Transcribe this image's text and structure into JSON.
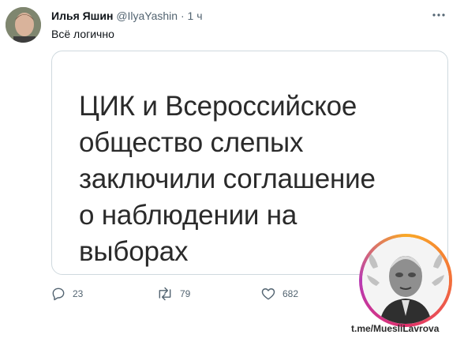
{
  "tweet": {
    "author_name": "Илья Яшин",
    "author_handle": "@IlyaYashin",
    "separator": "·",
    "time": "1 ч",
    "text": "Всё логично",
    "image_lines": [
      "ЦИК и Всероссийское",
      "общество слепых",
      "заключили соглашение",
      "о наблюдении на",
      "выборах"
    ]
  },
  "actions": {
    "reply_count": "23",
    "retweet_count": "79",
    "like_count": "682"
  },
  "watermark": {
    "text": "t.me/MuesliLavrova"
  },
  "icons": {
    "more": "more-icon",
    "reply": "reply-icon",
    "retweet": "retweet-icon",
    "like": "heart-icon"
  },
  "colors": {
    "text": "#0f1419",
    "secondary": "#536471",
    "border": "#cfd9de"
  }
}
